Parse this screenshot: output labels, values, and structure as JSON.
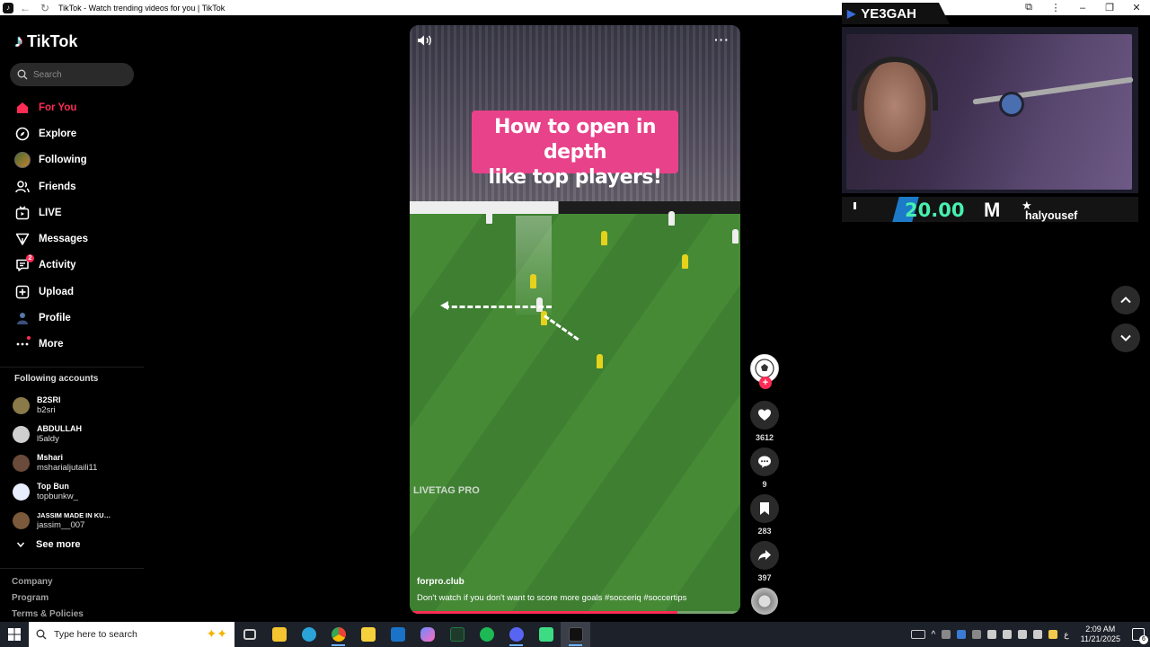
{
  "browser": {
    "title": "TikTok - Watch trending videos for you | TikTok"
  },
  "sidebar": {
    "logo": "TikTok",
    "search_placeholder": "Search",
    "nav": [
      {
        "label": "For You",
        "icon": "home-icon",
        "active": true
      },
      {
        "label": "Explore",
        "icon": "compass-icon"
      },
      {
        "label": "Following",
        "icon": "following-avatar"
      },
      {
        "label": "Friends",
        "icon": "friends-icon"
      },
      {
        "label": "LIVE",
        "icon": "live-icon"
      },
      {
        "label": "Messages",
        "icon": "messages-icon"
      },
      {
        "label": "Activity",
        "icon": "activity-icon",
        "badge": "2"
      },
      {
        "label": "Upload",
        "icon": "upload-icon"
      },
      {
        "label": "Profile",
        "icon": "profile-icon"
      },
      {
        "label": "More",
        "icon": "more-icon"
      }
    ],
    "following_title": "Following accounts",
    "accounts": [
      {
        "display": "B2SRI",
        "user": "b2sri",
        "color": "#8a7a4a"
      },
      {
        "display": "ABDULLAH",
        "user": "l5aldy",
        "color": "#cfcfcf"
      },
      {
        "display": "Mshari",
        "user": "msharialjutaili11",
        "color": "#6a4a3a"
      },
      {
        "display": "Top Bun",
        "user": "topbunkw_",
        "color": "#e8eefc"
      },
      {
        "display": "JASSIM MADE IN KU…",
        "user": "jassim__007",
        "color": "#7a5a3a"
      }
    ],
    "see_more": "See more",
    "footer": [
      "Company",
      "Program",
      "Terms & Policies"
    ]
  },
  "video": {
    "overlay_line1": "How to open in depth",
    "overlay_line2": "like top players!",
    "watermark": "LIVETAG PRO",
    "author": "forpro.club",
    "caption": "Don't watch if you don't want to score more goals #socceriq  #soccertips",
    "progress": 0.81
  },
  "actions": {
    "likes": "3612",
    "comments": "9",
    "saves": "283",
    "shares": "397"
  },
  "stream": {
    "channel": "YE3GAH",
    "amount": "20.00",
    "letter": "M",
    "donor": "halyousef"
  },
  "taskbar": {
    "search_placeholder": "Type here to search",
    "time": "2:09 AM",
    "date": "11/21/2025",
    "notifications": "6",
    "lang": "ع",
    "apps": [
      {
        "name": "task-view",
        "color": "#d0d0d0"
      },
      {
        "name": "file-explorer",
        "color": "#f4c430"
      },
      {
        "name": "edge",
        "color": "#2aa3d8"
      },
      {
        "name": "chrome",
        "color": "#34a853"
      },
      {
        "name": "store",
        "color": "#f5d03c"
      },
      {
        "name": "outlook",
        "color": "#1a73c8"
      },
      {
        "name": "copilot",
        "color": "#6a8cff"
      },
      {
        "name": "excel",
        "color": "#1f7a45"
      },
      {
        "name": "spotify",
        "color": "#1db954"
      },
      {
        "name": "discord",
        "color": "#5865f2"
      },
      {
        "name": "android-studio",
        "color": "#3ddc84"
      },
      {
        "name": "tiktok",
        "color": "#111111"
      }
    ]
  },
  "colors": {
    "accent": "#fe2c55",
    "background": "#000000"
  }
}
